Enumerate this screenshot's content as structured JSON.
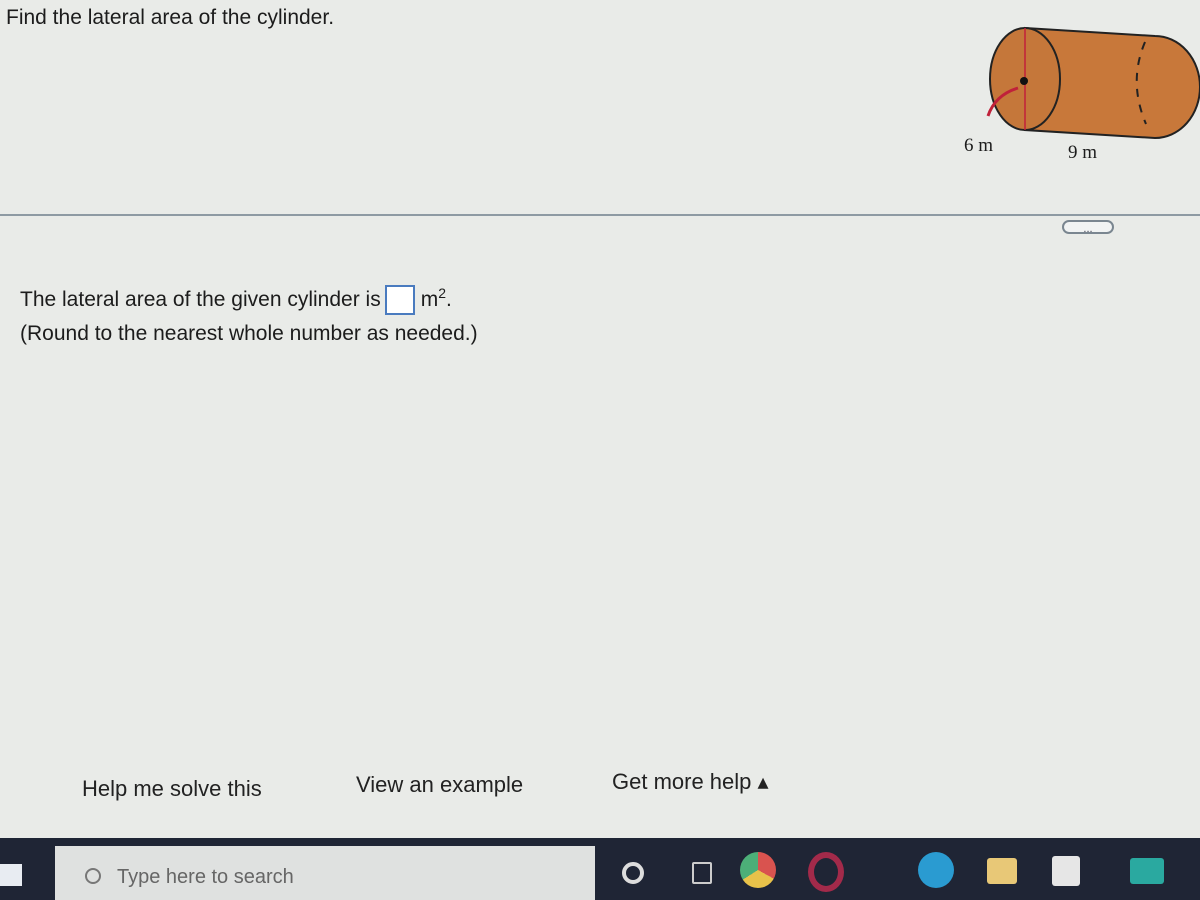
{
  "question": "Find the lateral area of the cylinder.",
  "figure": {
    "radius_label": "6 m",
    "height_label": "9 m",
    "fill_color": "#c8783a"
  },
  "more_button": "...",
  "answer": {
    "prefix": "The lateral area of the given cylinder is",
    "unit": "m",
    "exponent": "2",
    "suffix": ".",
    "input_value": "",
    "note": "(Round to the nearest whole number as needed.)"
  },
  "buttons": {
    "help": "Help me solve this",
    "example": "View an example",
    "more_help": "Get more help ▴"
  },
  "taskbar": {
    "search_placeholder": "Type here to search",
    "icons": [
      "windows-start-icon",
      "cortana-icon",
      "task-view-icon",
      "chrome-icon",
      "opera-icon",
      "edge-icon",
      "file-explorer-icon",
      "store-icon",
      "mail-icon"
    ]
  }
}
